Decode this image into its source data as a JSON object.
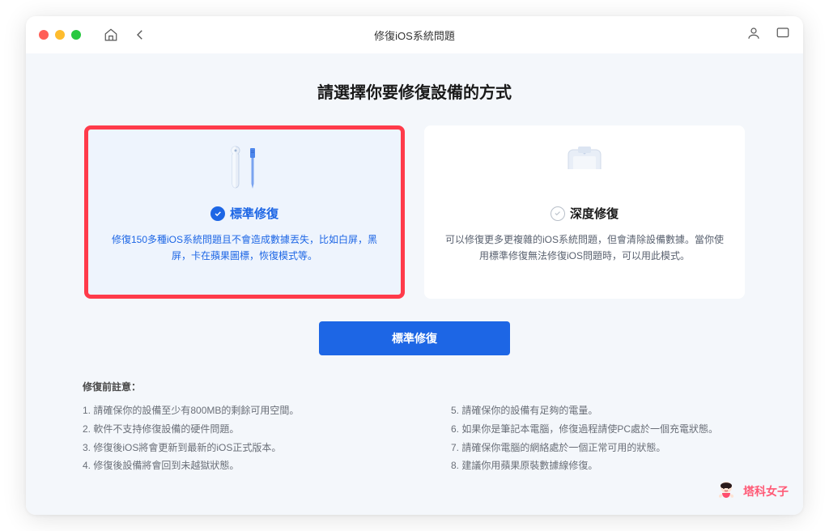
{
  "titlebar": {
    "title": "修復iOS系統問題"
  },
  "content": {
    "heading": "請選擇你要修復設備的方式"
  },
  "cards": {
    "standard": {
      "title": "標準修復",
      "desc": "修復150多種iOS系統問題且不會造成數據丟失，比如白屏，黑屏，卡在蘋果圖標，恢復模式等。"
    },
    "advanced": {
      "title": "深度修復",
      "desc": "可以修復更多更複雜的iOS系統問題，但會清除設備數據。當你使用標準修復無法修復iOS問題時，可以用此模式。"
    }
  },
  "button": {
    "primary": "標準修復"
  },
  "notes": {
    "title": "修復前註意：",
    "left": [
      "1. 請確保你的設備至少有800MB的剩餘可用空間。",
      "2. 軟件不支持修復設備的硬件問題。",
      "3. 修復後iOS將會更新到最新的iOS正式版本。",
      "4. 修復後設備將會回到未越獄狀態。"
    ],
    "right": [
      "5. 請確保你的設備有足夠的電量。",
      "6. 如果你是筆記本電腦，修復過程請使PC處於一個充電狀態。",
      "7. 請確保你電腦的網絡處於一個正常可用的狀態。",
      "8. 建議你用蘋果原裝數據線修復。"
    ]
  },
  "watermark": {
    "text": "塔科女子"
  }
}
